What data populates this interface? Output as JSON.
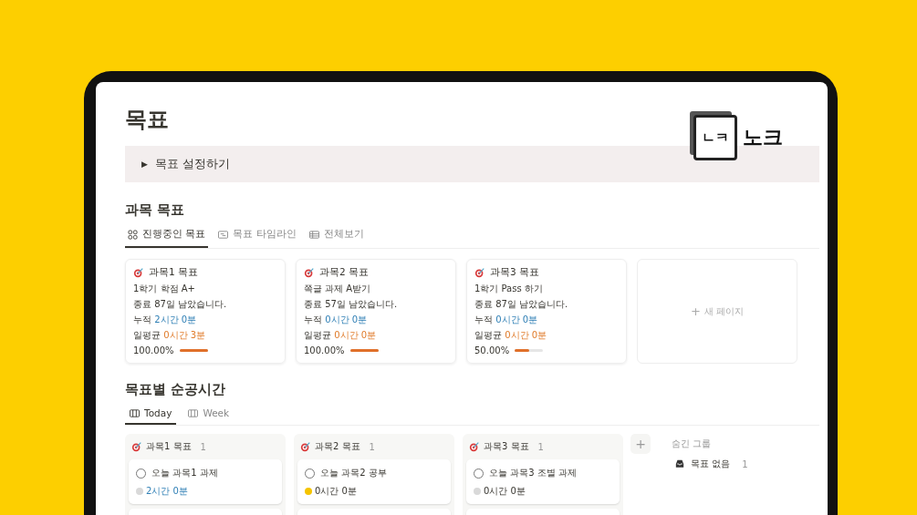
{
  "page": {
    "title": "목표",
    "toggle": {
      "label": "목표 설정하기",
      "expanded": false,
      "icon": "▶"
    }
  },
  "logo": {
    "mark": "ㄴㅋ",
    "name": "노크"
  },
  "subject_goals": {
    "heading": "과목 목표",
    "tabs": [
      {
        "label": "진행중인 목표",
        "selected": true,
        "kind": "gallery"
      },
      {
        "label": "목표 타임라인",
        "selected": false,
        "kind": "timeline"
      },
      {
        "label": "전체보기",
        "selected": false,
        "kind": "table"
      }
    ],
    "cards": [
      {
        "title": "과목1 목표",
        "goal": "1학기 학점 A+",
        "remaining": "종료 87일 남았습니다.",
        "total_label": "누적",
        "total": "2시간 0분",
        "avg_label": "일평균",
        "avg": "0시간 3분",
        "percent": "100.00%",
        "level": 1
      },
      {
        "title": "과목2 목표",
        "goal": "쪽글 과제 A받기",
        "remaining": "종료 57일 남았습니다.",
        "total_label": "누적",
        "total": "0시간 0분",
        "avg_label": "일평균",
        "avg": "0시간 0분",
        "percent": "100.00%",
        "level": 1
      },
      {
        "title": "과목3 목표",
        "goal": "1학기 Pass 하기",
        "remaining": "종료 87일 남았습니다.",
        "total_label": "누적",
        "total": "0시간 0분",
        "avg_label": "일평균",
        "avg": "0시간 0분",
        "percent": "50.00%",
        "level": 0.5
      }
    ],
    "new_page": {
      "icon": "+",
      "label": "새 페이지"
    }
  },
  "study_time": {
    "heading": "목표별 순공시간",
    "tabs": [
      {
        "label": "Today",
        "selected": true
      },
      {
        "label": "Week",
        "selected": false
      }
    ],
    "columns": [
      {
        "title": "과목1 목표",
        "count": "1",
        "items": [
          {
            "title": "오늘 과목1  과제",
            "checked": false,
            "time": "2시간 0분",
            "color": "#d9d9d9",
            "link": true
          }
        ]
      },
      {
        "title": "과목2 목표",
        "count": "1",
        "items": [
          {
            "title": "오늘 과목2 공부",
            "checked": false,
            "time": "0시간 0분",
            "color": "#f5c400",
            "link": false
          }
        ]
      },
      {
        "title": "과목3 목표",
        "count": "1",
        "items": [
          {
            "title": "오늘 과목3 조별 과제",
            "checked": false,
            "time": "0시간 0분",
            "color": "#d9d9d9",
            "link": false
          }
        ]
      }
    ],
    "add_icon": "+",
    "hidden": {
      "heading": "숨긴 그룹",
      "groups": [
        {
          "label": "목표 없음",
          "count": "1"
        }
      ]
    }
  }
}
